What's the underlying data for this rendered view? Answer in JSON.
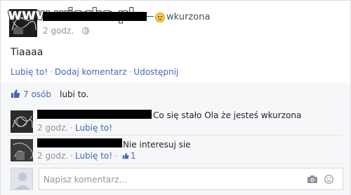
{
  "post": {
    "watermark": "www.wiocha.pl",
    "feeling_icon": "unamused-face-icon",
    "feeling": "wkurzona",
    "time": "2 godz.",
    "privacy_icon": "globe-icon",
    "text": "Tiaaaa",
    "actions": {
      "like": "Lubię to!",
      "comment": "Dodaj komentarz",
      "share": "Udostępnij"
    }
  },
  "likes": {
    "count": "7 osób",
    "suffix": "lubi to."
  },
  "comments": [
    {
      "text": "Co się stało Ola że jesteś wkurzona",
      "time": "2 godz.",
      "like": "Lubię to!"
    },
    {
      "text": "Nie interesuj sie",
      "time": "2 godz.",
      "like": "Lubię to!",
      "like_count": "1"
    }
  ],
  "composer": {
    "placeholder": "Napisz komentarz..."
  },
  "colors": {
    "link": "#4267b2",
    "meta": "#90949c",
    "background_light": "#f6f7f9"
  }
}
